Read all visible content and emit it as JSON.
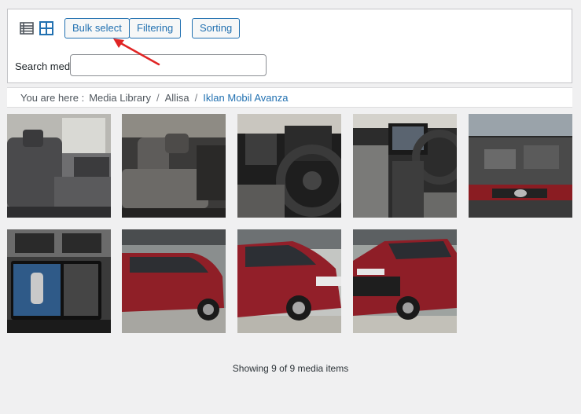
{
  "toolbar": {
    "view_list_icon": "list-view-icon",
    "view_grid_icon": "grid-view-icon",
    "bulk_select_label": "Bulk select",
    "filtering_label": "Filtering",
    "sorting_label": "Sorting",
    "search_label": "Search media",
    "search_value": "",
    "accent_color": "#2271b1"
  },
  "breadcrumb": {
    "prefix": "You are here :",
    "items": [
      "Media Library",
      "Allisa",
      "Iklan Mobil Avanza"
    ],
    "separator": "/"
  },
  "media": {
    "items": [
      {
        "name": "car-interior-rear-seat-image"
      },
      {
        "name": "car-interior-seats-image"
      },
      {
        "name": "car-steering-wheel-image"
      },
      {
        "name": "car-dashboard-console-image"
      },
      {
        "name": "car-engine-bay-image"
      },
      {
        "name": "car-head-unit-camera-image"
      },
      {
        "name": "red-car-side-image"
      },
      {
        "name": "red-car-front-side-image"
      },
      {
        "name": "red-car-front-image"
      }
    ],
    "count_text": "Showing 9 of 9 media items"
  }
}
